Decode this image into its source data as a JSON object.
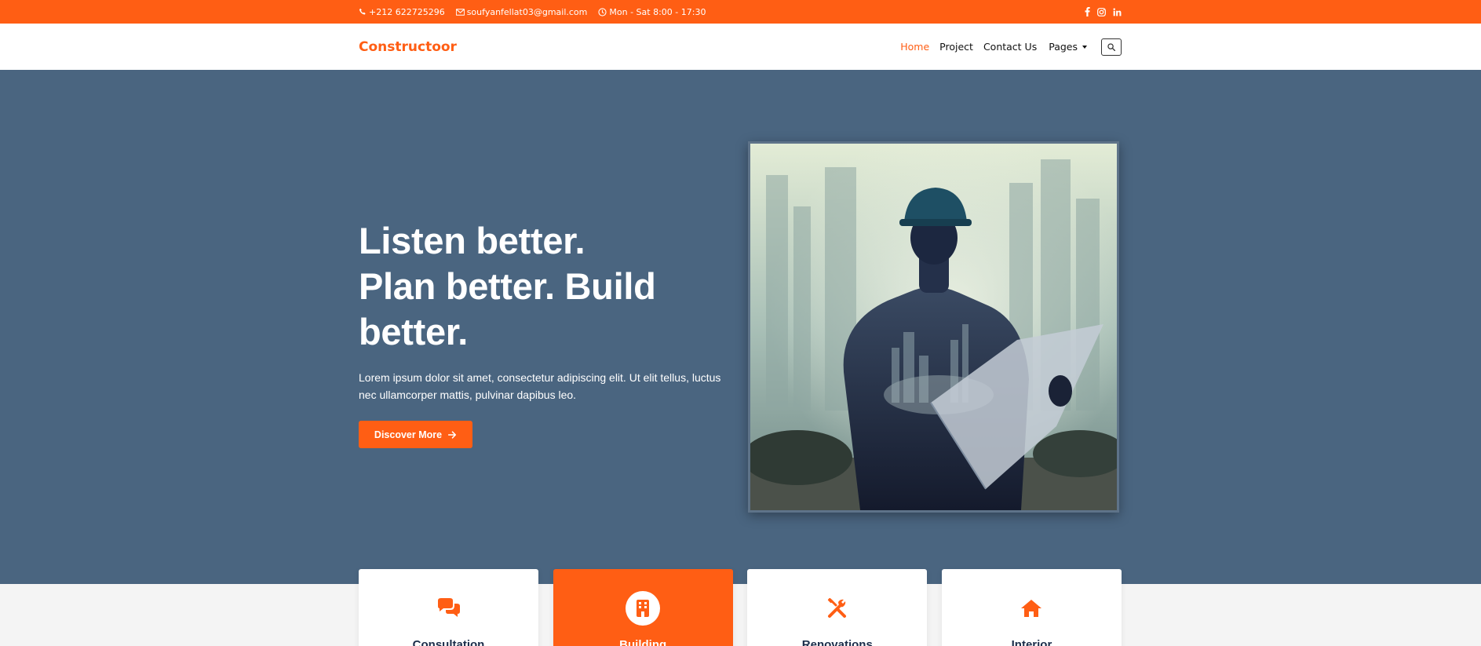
{
  "topbar": {
    "phone": "+212 622725296",
    "email": "soufyanfellat03@gmail.com",
    "hours": "Mon - Sat 8:00 - 17:30",
    "social": [
      "facebook-icon",
      "instagram-icon",
      "linkedin-icon"
    ]
  },
  "nav": {
    "brand": "Constructoor",
    "items": [
      {
        "label": "Home",
        "active": true
      },
      {
        "label": "Project",
        "active": false
      },
      {
        "label": "Contact Us",
        "active": false
      }
    ],
    "pages_label": "Pages"
  },
  "hero": {
    "title_line1": "Listen better.",
    "title_line2": "Plan better. Build",
    "title_line3": "better.",
    "description": "Lorem ipsum dolor sit amet, consectetur adipiscing elit. Ut elit tellus, luctus nec ullamcorper mattis, pulvinar dapibus leo.",
    "button_label": "Discover More"
  },
  "services": [
    {
      "title": "Consultation",
      "icon": "chat-bubbles-icon",
      "active": false
    },
    {
      "title": "Building",
      "icon": "building-icon",
      "active": true
    },
    {
      "title": "Renovations",
      "icon": "tools-icon",
      "active": false
    },
    {
      "title": "Interior",
      "icon": "home-icon",
      "active": false
    }
  ],
  "colors": {
    "accent": "#ff5e14",
    "hero_bg": "#4a6580",
    "heading_dark": "#1b2d4a"
  }
}
